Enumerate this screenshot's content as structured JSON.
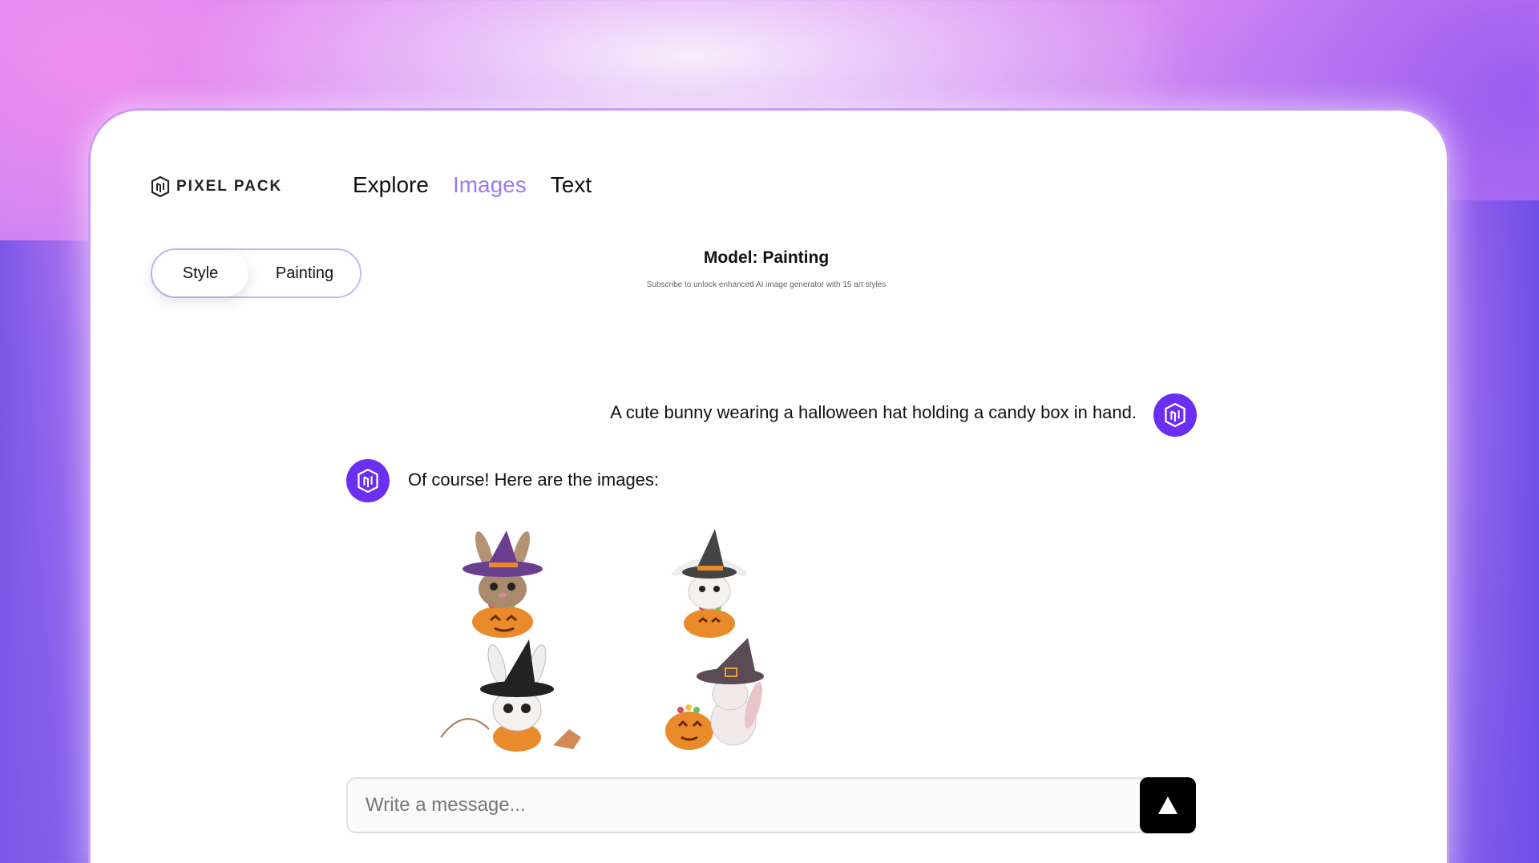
{
  "brand": {
    "name": "PIXEL PACK",
    "icon": "pixel-pack-logo-icon"
  },
  "nav": {
    "items": [
      {
        "label": "Explore"
      },
      {
        "label": "Images",
        "active": true
      },
      {
        "label": "Text"
      }
    ]
  },
  "toggle": {
    "style_label": "Style",
    "painting_label": "Painting"
  },
  "model": {
    "title": "Model: Painting",
    "subtitle": "Subscribe to unlock enhanced AI image generator with 15 art styles"
  },
  "chat": {
    "user_message": "A cute bunny wearing a halloween hat holding a candy box in hand.",
    "bot_message": "Of course! Here are the images:",
    "images_count": 4
  },
  "composer": {
    "placeholder": "Write a message...",
    "send_icon": "send-arrow-icon"
  },
  "colors": {
    "accent": "#6a2ff0",
    "nav_active": "#9b7cf0",
    "pumpkin": "#e98a2b"
  }
}
